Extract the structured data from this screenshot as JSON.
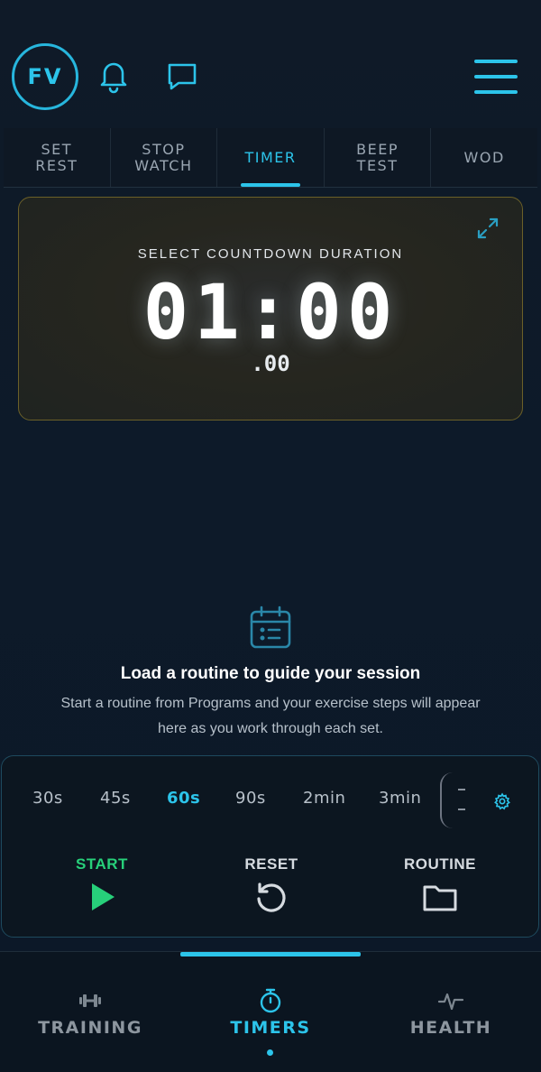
{
  "header": {
    "avatar_initials": "FV",
    "icons": [
      "bell-icon",
      "chat-icon",
      "menu-icon"
    ],
    "accent_color": "#2cc4ea"
  },
  "tabs": [
    {
      "label": "SET\nREST",
      "active": false
    },
    {
      "label": "STOP\nWATCH",
      "active": false
    },
    {
      "label": "TIMER",
      "active": true
    },
    {
      "label": "BEEP\nTEST",
      "active": false
    },
    {
      "label": "WOD",
      "active": false
    }
  ],
  "timer": {
    "label": "SELECT COUNTDOWN DURATION",
    "display": "01:00",
    "milliseconds": ".00"
  },
  "routine": {
    "title": "Load a routine to guide your session",
    "description": "Start a routine from Programs and your exercise steps will appear here as you work through each set."
  },
  "presets": [
    {
      "label": "30s",
      "active": false
    },
    {
      "label": "45s",
      "active": false
    },
    {
      "label": "60s",
      "active": true
    },
    {
      "label": "90s",
      "active": false
    },
    {
      "label": "2min",
      "active": false
    },
    {
      "label": "3min",
      "active": false
    }
  ],
  "controls": {
    "start": "START",
    "reset": "RESET",
    "routine": "ROUTINE",
    "start_color": "#27d07a"
  },
  "nav": {
    "training": "TRAINING",
    "timers": "TIMERS",
    "health": "HEALTH",
    "active": "timers"
  }
}
